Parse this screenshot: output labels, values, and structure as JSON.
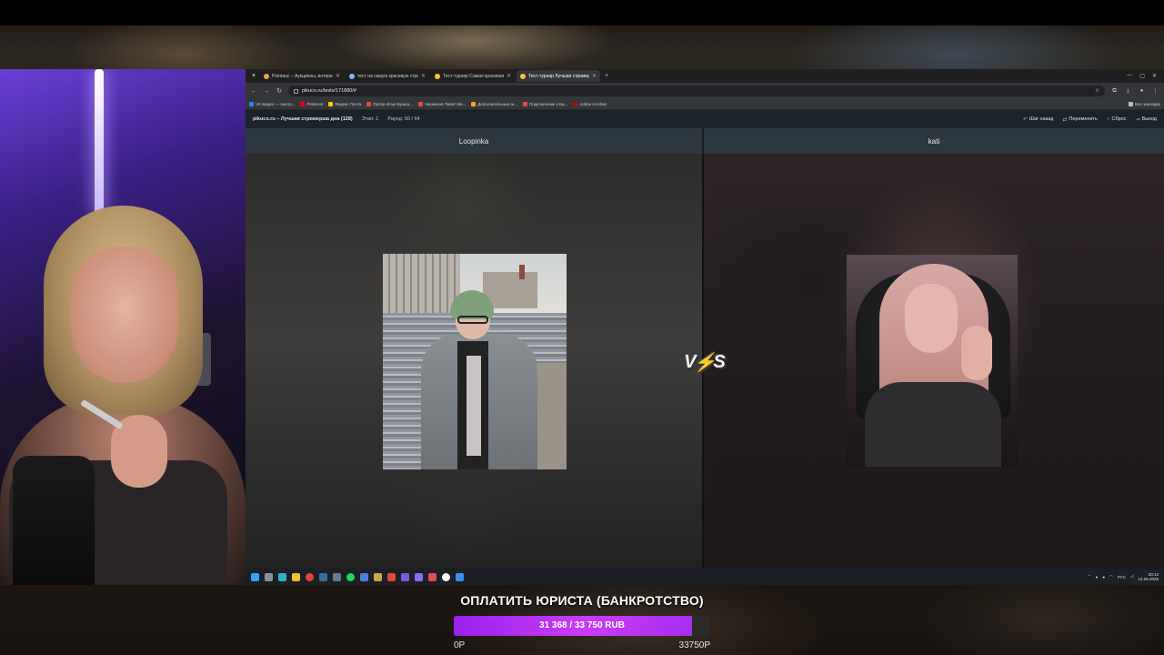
{
  "browser": {
    "tabs": [
      {
        "label": "Pointauc – Аукционы, интерес",
        "color": "#e0a84a",
        "active": false
      },
      {
        "label": "тест на самую красивую стри",
        "color": "#8ab4f8",
        "active": false
      },
      {
        "label": "Тест-турнир Самая красивая",
        "color": "#f4c542",
        "active": false
      },
      {
        "label": "Тест-турнир Лучшая стример",
        "color": "#f4c542",
        "active": true
      }
    ],
    "new_tab": "+",
    "url": "pikuco.ru/tests/171880/#",
    "bookmarks": [
      {
        "label": "VK Видео — смотр...",
        "color": "#2787f5"
      },
      {
        "label": "Pinterest",
        "color": "#e60023"
      },
      {
        "label": "Яндекс Почта",
        "color": "#ffcc00"
      },
      {
        "label": "Орлов Илья Бушка...",
        "color": "#e84a3a"
      },
      {
        "label": "Черемхов Павел Ви...",
        "color": "#e84a3a"
      },
      {
        "label": "Дополнительные м...",
        "color": "#f5a623"
      },
      {
        "label": "Подключение к Би...",
        "color": "#e84a3a"
      },
      {
        "label": "Adobe Acrobat",
        "color": "#b30b00"
      }
    ],
    "bookmarks_all": "Все закладки"
  },
  "site": {
    "title": "pikuco.ru – Лучшая стримерша дна (128)",
    "stage": "Этап: 1",
    "round": "Раунд: 50 / 64",
    "actions": [
      {
        "label": "Шаг назад",
        "icon": "undo-icon"
      },
      {
        "label": "Переменить",
        "icon": "shuffle-icon"
      },
      {
        "label": "Сброс",
        "icon": "reset-icon"
      },
      {
        "label": "Выход",
        "icon": "exit-icon"
      }
    ]
  },
  "duel": {
    "left_name": "Loopinka",
    "right_name": "kati",
    "vs_left": "V",
    "vs_bolt": "⚡",
    "vs_right": "S"
  },
  "taskbar": {
    "lang": "РУС",
    "time": "20:14",
    "date": "14.05.2026"
  },
  "goal": {
    "title": "ОПЛАТИТЬ ЮРИСТА (БАНКРОТСТВО)",
    "amount_text": "31 368 / 33 750 RUB",
    "current": 31368,
    "target": 33750,
    "min_label": "0Р",
    "max_label": "33750Р",
    "fill_color": "#b02ff0"
  }
}
